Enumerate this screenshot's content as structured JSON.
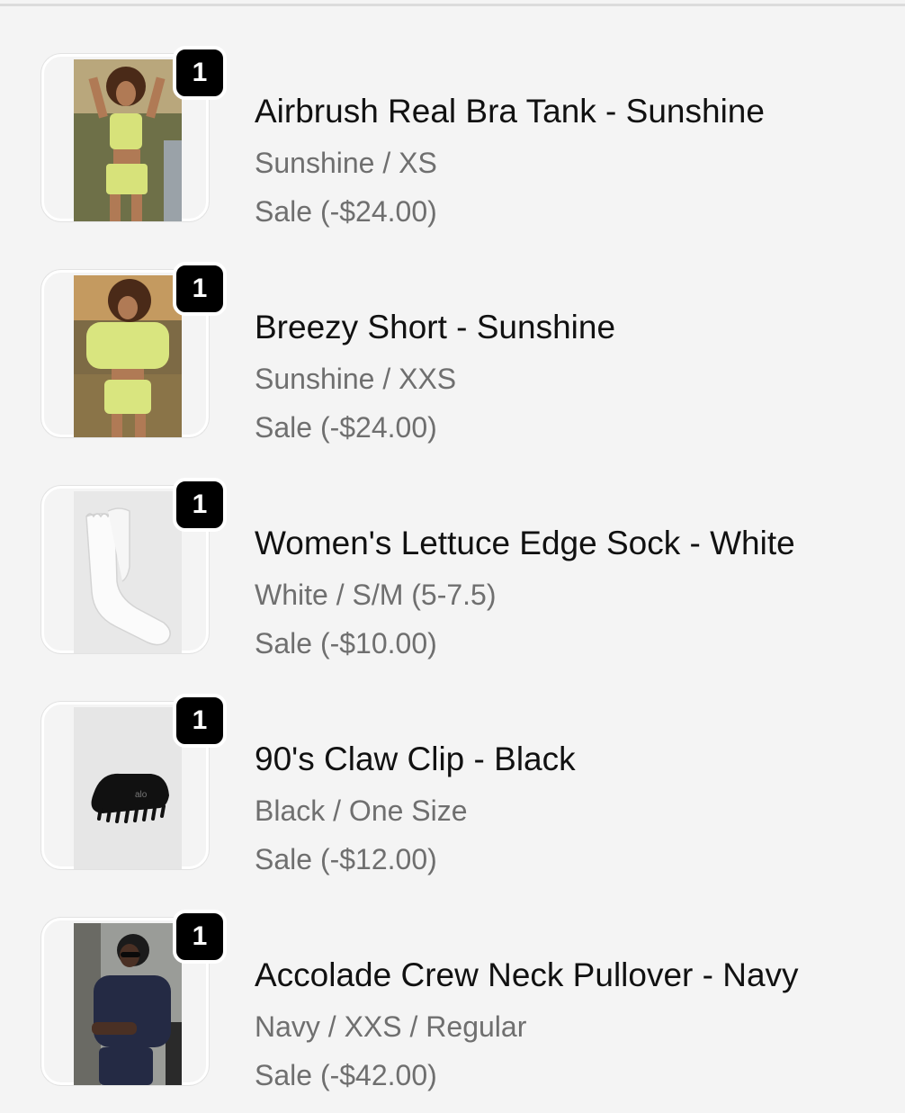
{
  "items": [
    {
      "quantity": "1",
      "title": "Airbrush Real Bra Tank - Sunshine",
      "variant": "Sunshine / XS",
      "discount": "Sale (-$24.00)",
      "image": "woman-in-yellow-set-photo"
    },
    {
      "quantity": "1",
      "title": "Breezy Short - Sunshine",
      "variant": "Sunshine / XXS",
      "discount": "Sale (-$24.00)",
      "image": "woman-in-yellow-sweatshirt-photo"
    },
    {
      "quantity": "1",
      "title": "Women's Lettuce Edge Sock - White",
      "variant": "White / S/M (5-7.5)",
      "discount": "Sale (-$10.00)",
      "image": "white-sock-photo"
    },
    {
      "quantity": "1",
      "title": "90's Claw Clip - Black",
      "variant": "Black / One Size",
      "discount": "Sale (-$12.00)",
      "image": "black-claw-clip-photo"
    },
    {
      "quantity": "1",
      "title": "Accolade Crew Neck Pullover - Navy",
      "variant": "Navy / XXS / Regular",
      "discount": "Sale (-$42.00)",
      "image": "woman-in-navy-pullover-photo"
    }
  ],
  "colors": {
    "background": "#f4f4f4",
    "badge": "#000000",
    "title_text": "#111111",
    "secondary_text": "#6f6f6f"
  }
}
